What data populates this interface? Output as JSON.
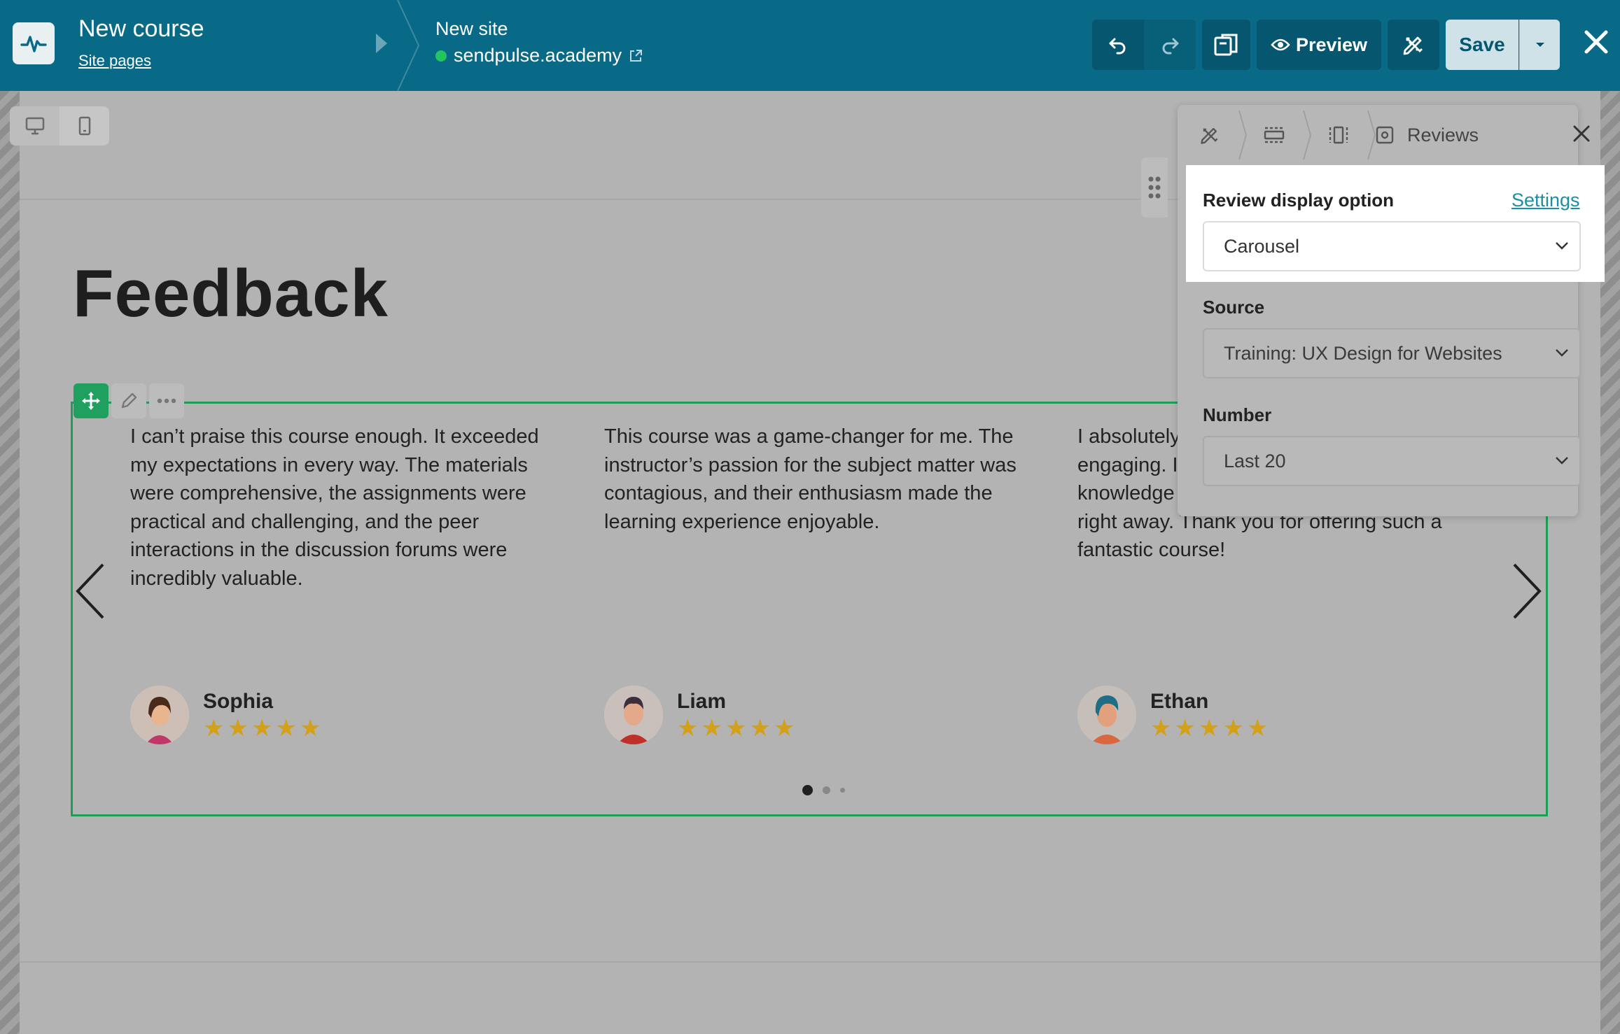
{
  "header": {
    "course_title": "New course",
    "course_subtitle": "Site pages",
    "site_title": "New site",
    "site_url": "sendpulse.academy",
    "preview_label": "Preview",
    "save_label": "Save"
  },
  "content": {
    "heading": "Feedback",
    "reviews": [
      {
        "text": "I can’t praise this course enough. It exceeded my expectations in every way. The materials were comprehensive, the assignments were practical and challenging, and the peer interactions in the discussion forums were incredibly valuable.",
        "name": "Sophia",
        "rating": 5
      },
      {
        "text": "This course was a game-changer for me. The instructor’s passion for the subject matter was contagious, and their enthusiasm made the learning experience enjoyable.",
        "name": "Liam",
        "rating": 5
      },
      {
        "text": "I absolutely ... was well-st... the instruc... engaging. I feel like I’ve gained valuable knowledge and skills that I can apply in my job right away. Thank you for offering such a fantastic course!",
        "name": "Ethan",
        "rating": 5
      }
    ],
    "carousel_pages": 3,
    "carousel_active": 1
  },
  "panel": {
    "tab_title": "Reviews",
    "display_label": "Review display option",
    "settings_link": "Settings",
    "display_value": "Carousel",
    "source_label": "Source",
    "source_value": "Training: UX Design for Websites",
    "number_label": "Number",
    "number_value": "Last 20"
  },
  "colors": {
    "topbar": "#086a86",
    "accent_green": "#1f9d57",
    "star": "#d4a017",
    "link": "#1a8fa6"
  }
}
